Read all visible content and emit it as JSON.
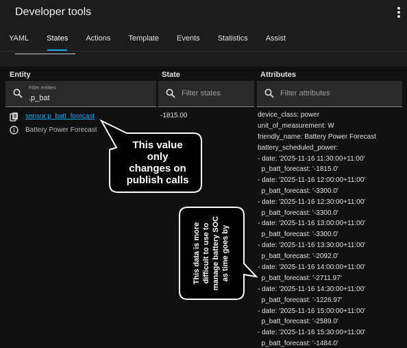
{
  "app": {
    "title": "Developer tools"
  },
  "tabs": [
    {
      "label": "YAML"
    },
    {
      "label": "States"
    },
    {
      "label": "Actions"
    },
    {
      "label": "Template"
    },
    {
      "label": "Events"
    },
    {
      "label": "Statistics"
    },
    {
      "label": "Assist"
    }
  ],
  "active_tab": "States",
  "columns": {
    "entity": "Entity",
    "state": "State",
    "attributes": "Attributes"
  },
  "filters": {
    "entity_label": "Filter entities",
    "entity_value": ".p_bat",
    "state_placeholder": "Filter states",
    "attributes_placeholder": "Filter attributes"
  },
  "row": {
    "entity_id": "sensor.p_batt_forecast",
    "friendly_name": "Battery Power Forecast",
    "state": "-1815.00"
  },
  "attributes": [
    "device_class: power",
    "unit_of_measurement: W",
    "friendly_name: Battery Power Forecast",
    "battery_scheduled_power:",
    "- date: '2025-11-16 11:30:00+11:00'",
    "  p_batt_forecast: '-1815.0'",
    "- date: '2025-11-16 12:00:00+11:00'",
    "  p_batt_forecast: '-3300.0'",
    "- date: '2025-11-16 12:30:00+11:00'",
    "  p_batt_forecast: '-3300.0'",
    "- date: '2025-11-16 13:00:00+11:00'",
    "  p_batt_forecast: '-3300.0'",
    "- date: '2025-11-16 13:30:00+11:00'",
    "  p_batt_forecast: '-2092.0'",
    "- date: '2025-11-16 14:00:00+11:00'",
    "  p_batt_forecast: '-2711.97'",
    "- date: '2025-11-16 14:30:00+11:00'",
    "  p_batt_forecast: '-1226.97'",
    "- date: '2025-11-16 15:00:00+11:00'",
    "  p_batt_forecast: '-2589.0'",
    "- date: '2025-11-16 15:30:00+11:00'",
    "  p_batt_forecast: '-1484.0'"
  ],
  "callouts": {
    "top": [
      "This value",
      "only",
      "changes on",
      "publish calls"
    ],
    "side": [
      "This data is more",
      "difficult to use to",
      "manage battery SOC",
      "as time goes by"
    ]
  },
  "colors": {
    "accent": "#03a9f4",
    "background": "#111111",
    "bar": "#1c1c1c"
  }
}
